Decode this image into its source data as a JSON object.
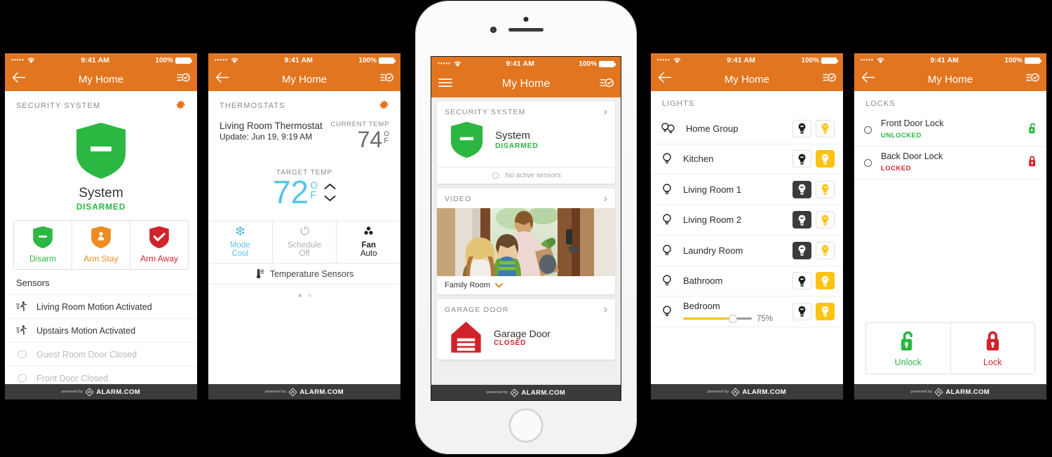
{
  "status_bar": {
    "carrier_dots": "•••••",
    "time": "9:41 AM",
    "battery_pct": "100%"
  },
  "nav": {
    "title": "My Home"
  },
  "footer": {
    "powered_by": "powered by",
    "brand": "ALARM.COM"
  },
  "colors": {
    "brand_orange": "#E2751F",
    "green": "#2CB742",
    "red": "#D0232B",
    "amber": "#FFC20E",
    "cyan": "#59C5E8",
    "dark": "#3B3B3B"
  },
  "screen_security": {
    "section_title": "SECURITY SYSTEM",
    "system_name": "System",
    "system_state": "DISARMED",
    "arm_buttons": [
      {
        "label": "Disarm",
        "color": "#2CB742",
        "icon": "shield-minus-icon"
      },
      {
        "label": "Arm Stay",
        "color": "#F08A22",
        "icon": "shield-person-icon"
      },
      {
        "label": "Arm Away",
        "color": "#D0232B",
        "icon": "shield-check-icon"
      }
    ],
    "sensors_title": "Sensors",
    "sensors": [
      {
        "label": "Living Room Motion Activated",
        "active": true,
        "icon": "motion-icon"
      },
      {
        "label": "Upstairs Motion Activated",
        "active": true,
        "icon": "motion-icon"
      },
      {
        "label": "Guest Room Door Closed",
        "active": false,
        "icon": "contact-sensor-icon"
      },
      {
        "label": "Front Door Closed",
        "active": false,
        "icon": "contact-sensor-icon"
      }
    ]
  },
  "screen_thermostat": {
    "section_title": "THERMOSTATS",
    "device_name": "Living Room Thermostat",
    "update_text": "Update: Jun 19, 9:19 AM",
    "current_temp_label": "CURRENT TEMP",
    "current_temp": "74",
    "degree_symbol": "O",
    "unit": "F",
    "target_temp_label": "TARGET TEMP",
    "target_temp": "72",
    "modes": [
      {
        "line1": "Mode",
        "line2": "Cool",
        "icon": "snowflake-icon",
        "active": true
      },
      {
        "line1": "Schedule",
        "line2": "Off",
        "icon": "clock-icon",
        "active": false
      },
      {
        "line1": "Fan",
        "line2": "Auto",
        "icon": "fan-icon",
        "active": null
      }
    ],
    "temp_sensors_label": "Temperature Sensors",
    "pager": {
      "pages": 2,
      "current": 1
    }
  },
  "screen_dashboard": {
    "security": {
      "section_title": "SECURITY SYSTEM",
      "system_name": "System",
      "system_state": "DISARMED",
      "footer_note": "No active sensors"
    },
    "video": {
      "section_title": "VIDEO",
      "camera_name": "Family Room"
    },
    "garage": {
      "section_title": "GARAGE DOOR",
      "device_name": "Garage Door",
      "state": "CLOSED"
    }
  },
  "screen_lights": {
    "section_title": "LIGHTS",
    "lights": [
      {
        "name": "Home Group",
        "icon": "light-group-icon",
        "off_state": "inactive",
        "on_state": "inactive"
      },
      {
        "name": "Kitchen",
        "icon": "bulb-icon",
        "off_state": "inactive",
        "on_state": "active"
      },
      {
        "name": "Living Room 1",
        "icon": "bulb-icon",
        "off_state": "active",
        "on_state": "inactive"
      },
      {
        "name": "Living Room 2",
        "icon": "bulb-icon",
        "off_state": "active",
        "on_state": "inactive"
      },
      {
        "name": "Laundry Room",
        "icon": "bulb-icon",
        "off_state": "active",
        "on_state": "inactive"
      },
      {
        "name": "Bathroom",
        "icon": "bulb-icon",
        "off_state": "inactive",
        "on_state": "active"
      },
      {
        "name": "Bedroom",
        "icon": "bulb-icon",
        "off_state": "inactive",
        "on_state": "active",
        "dimmer": {
          "value": 75,
          "label": "75%"
        }
      }
    ]
  },
  "screen_locks": {
    "section_title": "LOCKS",
    "locks": [
      {
        "name": "Front Door Lock",
        "state": "UNLOCKED",
        "state_class": "unlocked"
      },
      {
        "name": "Back Door Lock",
        "state": "LOCKED",
        "state_class": "locked"
      }
    ],
    "actions": [
      {
        "label": "Unlock",
        "icon": "unlock-icon",
        "color": "#2CB742"
      },
      {
        "label": "Lock",
        "icon": "lock-icon",
        "color": "#D0232B"
      }
    ]
  }
}
